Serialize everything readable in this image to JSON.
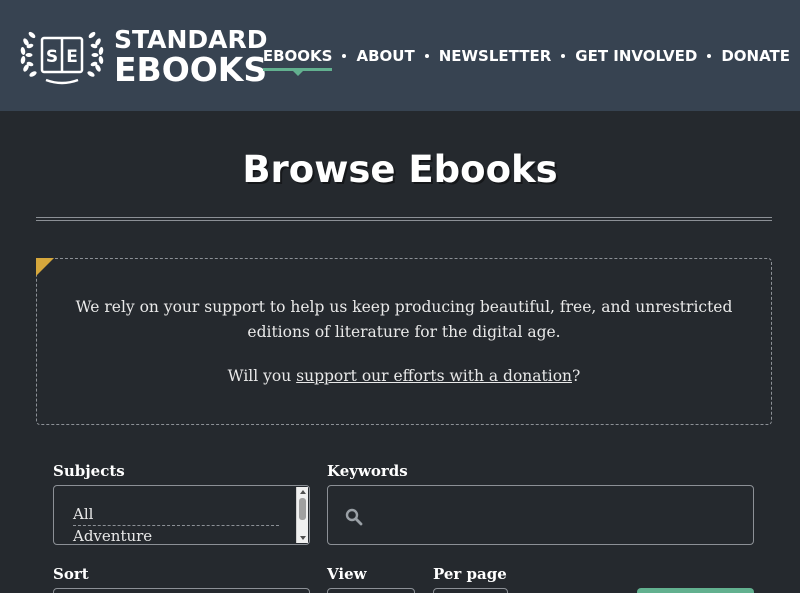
{
  "header": {
    "logo": {
      "monogram": "SE",
      "line1": "STANDARD",
      "line2": "EBOOKS"
    },
    "nav": [
      {
        "label": "EBOOKS",
        "active": true
      },
      {
        "label": "ABOUT",
        "active": false
      },
      {
        "label": "NEWSLETTER",
        "active": false
      },
      {
        "label": "GET INVOLVED",
        "active": false
      },
      {
        "label": "DONATE",
        "active": false
      }
    ],
    "colors": {
      "background": "#374351",
      "active_indicator": "#62b08f"
    }
  },
  "main": {
    "title": "Browse Ebooks",
    "donation": {
      "message": "We rely on your support to help us keep producing beautiful, free, and unrestricted editions of literature for the digital age.",
      "ask_prefix": "Will you ",
      "ask_link": "support our efforts with a donation",
      "ask_suffix": "?",
      "corner_color": "#d6a73c"
    },
    "filters": {
      "subjects_label": "Subjects",
      "subjects_options": [
        "All",
        "Adventure"
      ],
      "subjects_selected": "All",
      "keywords_label": "Keywords",
      "keywords_value": "",
      "keywords_icon": "search-icon",
      "sort_label": "Sort",
      "view_label": "View",
      "per_page_label": "Per page"
    }
  },
  "colors": {
    "page_background": "#25292e",
    "accent": "#62b08f"
  }
}
